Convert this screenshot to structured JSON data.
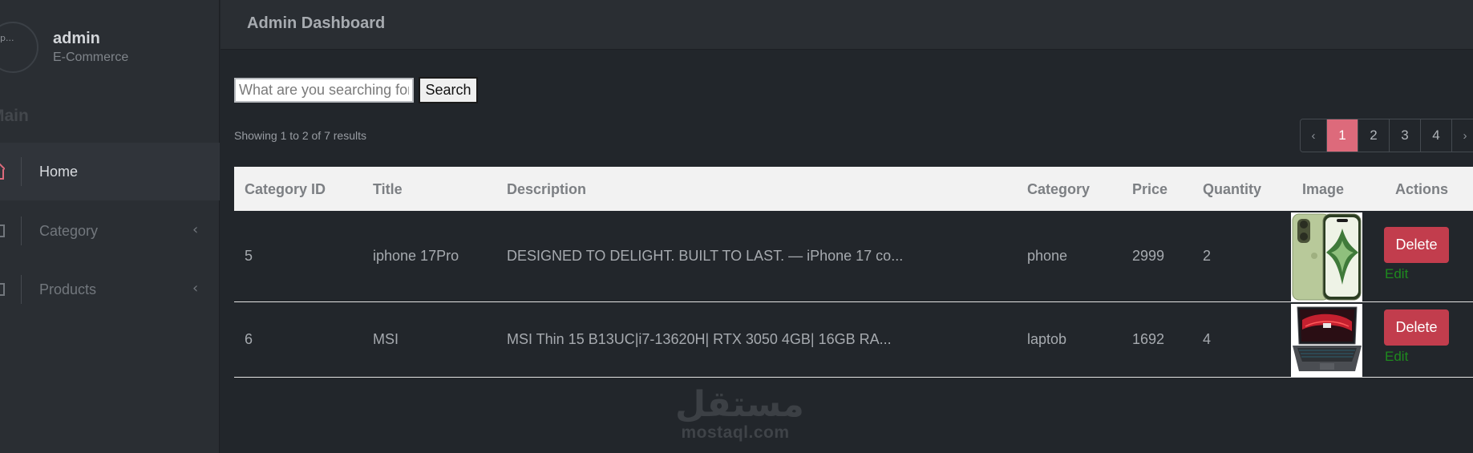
{
  "sidebar": {
    "profile": {
      "name": "admin",
      "role": "E-Commerce",
      "avatar_alt": "p..."
    },
    "section_header": "Main",
    "items": [
      {
        "label": "Home",
        "icon": "home-icon",
        "active": true
      },
      {
        "label": "Category",
        "icon": "category-icon",
        "chevron": "‹"
      },
      {
        "label": "Products",
        "icon": "products-icon",
        "chevron": "‹"
      }
    ]
  },
  "header": {
    "title": "Admin Dashboard"
  },
  "search": {
    "placeholder": "What are you searching for",
    "button_label": "Search"
  },
  "results": {
    "summary": "Showing 1 to 2 of 7 results"
  },
  "pagination": {
    "prev": "‹",
    "pages": [
      "1",
      "2",
      "3",
      "4"
    ],
    "next": "›",
    "current": "1"
  },
  "table": {
    "columns": [
      "Category ID",
      "Title",
      "Description",
      "Category",
      "Price",
      "Quantity",
      "Image",
      "Actions"
    ],
    "rows": [
      {
        "id": "5",
        "title": "iphone 17Pro",
        "description": "DESIGNED TO DELIGHT. BUILT TO LAST. — iPhone 17 co...",
        "category": "phone",
        "price": "2999",
        "quantity": "2",
        "image": "iphone-product-image",
        "delete_label": "Delete",
        "edit_label": "Edit"
      },
      {
        "id": "6",
        "title": "MSI",
        "description": "MSI Thin 15 B13UC|i7-13620H| RTX 3050 4GB| 16GB RA...",
        "category": "laptob",
        "price": "1692",
        "quantity": "4",
        "image": "laptop-product-image",
        "delete_label": "Delete",
        "edit_label": "Edit"
      }
    ]
  },
  "watermark": {
    "arabic": "مستقل",
    "latin": "mostaql.com"
  },
  "colors": {
    "background": "#22262b",
    "sidebar": "#2a2e33",
    "accent_page": "#dd6a7b",
    "delete": "#c23d4d",
    "edit": "#1e8a1e"
  }
}
